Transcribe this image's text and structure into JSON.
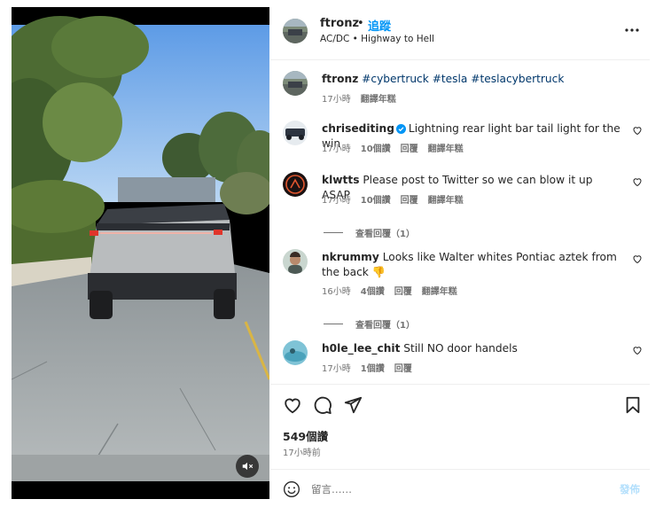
{
  "header": {
    "username": "ftronz",
    "separator": "•",
    "follow_label": "追蹤",
    "song": "AC/DC • Highway to Hell",
    "more_icon": "more-horizontal-icon"
  },
  "caption": {
    "username": "ftronz",
    "hashtags": "#cybertruck #tesla #teslacybertruck",
    "time": "17小時",
    "translate": "翻譯年糕"
  },
  "comments": [
    {
      "username": "chrisediting",
      "verified": true,
      "text": "Lightning rear light bar tail light for the win",
      "time": "17小時",
      "likes": "10個讚",
      "reply": "回覆",
      "translate": "翻譯年糕"
    },
    {
      "username": "klwtts",
      "text": "Please post to Twitter so we can blow it up ASAP",
      "time": "17小時",
      "likes": "10個讚",
      "reply": "回覆",
      "translate": "翻譯年糕",
      "view_replies": "查看回覆（1）"
    },
    {
      "username": "nkrummy",
      "text": "Looks like Walter whites Pontiac aztek from the back 👎",
      "time": "16小時",
      "likes": "4個讚",
      "reply": "回覆",
      "translate": "翻譯年糕",
      "view_replies": "查看回覆（1）"
    },
    {
      "username": "h0le_lee_chit",
      "text": "Still NO door handels",
      "time": "17小時",
      "likes": "1個讚",
      "reply": "回覆"
    }
  ],
  "actions": {
    "like_icon": "heart-icon",
    "comment_icon": "comment-bubble-icon",
    "share_icon": "paper-plane-icon",
    "save_icon": "bookmark-icon"
  },
  "stats": {
    "likes": "549個讚",
    "posted": "17小時前"
  },
  "composer": {
    "placeholder": "留言……",
    "post_label": "發佈",
    "emoji_icon": "emoji-smile-icon"
  },
  "video": {
    "mute_icon": "speaker-muted-icon"
  },
  "colors": {
    "link_blue": "#0095f6",
    "hashtag_blue": "#00376b",
    "muted_text": "#737373",
    "post_disabled": "#b2dffc",
    "verified_badge": "#0095f6"
  }
}
